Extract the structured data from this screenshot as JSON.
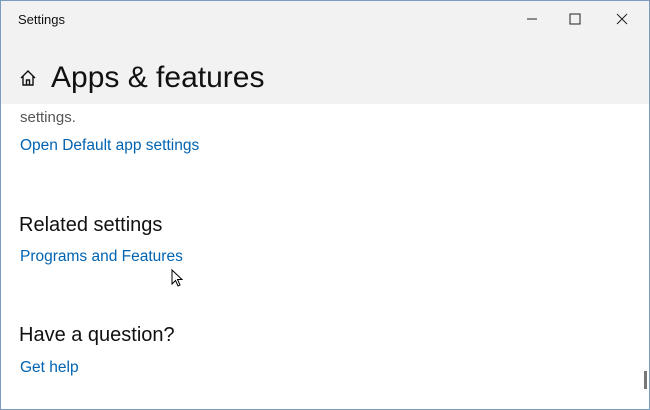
{
  "window": {
    "title": "Settings"
  },
  "header": {
    "page_title": "Apps & features"
  },
  "content": {
    "truncated_text": "settings.",
    "default_app_link": "Open Default app settings",
    "related_heading": "Related settings",
    "programs_link": "Programs and Features",
    "question_heading": "Have a question?",
    "help_link": "Get help"
  }
}
